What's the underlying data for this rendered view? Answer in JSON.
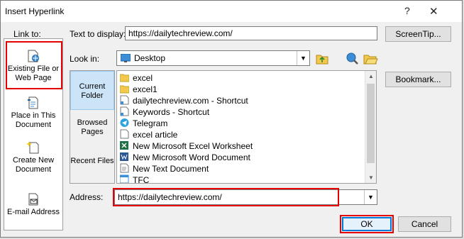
{
  "window": {
    "title": "Insert Hyperlink",
    "help": "?",
    "close": "✕"
  },
  "link_to": {
    "label": "Link to:",
    "items": [
      {
        "label": "Existing File or Web Page",
        "icon": "existing-file-icon",
        "selected": true
      },
      {
        "label": "Place in This Document",
        "icon": "place-in-document-icon"
      },
      {
        "label": "Create New Document",
        "icon": "new-document-icon"
      },
      {
        "label": "E-mail Address",
        "icon": "email-icon"
      }
    ]
  },
  "text_to_display": {
    "label": "Text to display:",
    "value": "https://dailytechreview.com/"
  },
  "screentip_label": "ScreenTip...",
  "look_in": {
    "label": "Look in:",
    "value": "Desktop"
  },
  "bookmark_label": "Bookmark...",
  "side_buttons": [
    {
      "label": "Current Folder",
      "active": true
    },
    {
      "label": "Browsed Pages"
    },
    {
      "label": "Recent Files"
    }
  ],
  "files": [
    {
      "name": "excel",
      "icon": "folder-icon"
    },
    {
      "name": "excel1",
      "icon": "folder-icon"
    },
    {
      "name": "dailytechreview.com - Shortcut",
      "icon": "shortcut-icon"
    },
    {
      "name": "Keywords - Shortcut",
      "icon": "shortcut-icon"
    },
    {
      "name": "Telegram",
      "icon": "telegram-icon"
    },
    {
      "name": "excel article",
      "icon": "document-icon"
    },
    {
      "name": "New Microsoft Excel Worksheet",
      "icon": "excel-icon"
    },
    {
      "name": "New Microsoft Word Document",
      "icon": "word-icon"
    },
    {
      "name": "New Text Document",
      "icon": "text-file-icon"
    },
    {
      "name": "TFC",
      "icon": "app-icon"
    }
  ],
  "address": {
    "label": "Address:",
    "value": "https://dailytechreview.com/"
  },
  "ok_label": "OK",
  "cancel_label": "Cancel",
  "colors": {
    "highlight": "#e60000",
    "selection": "#cce4f7",
    "accent": "#0078d7"
  }
}
